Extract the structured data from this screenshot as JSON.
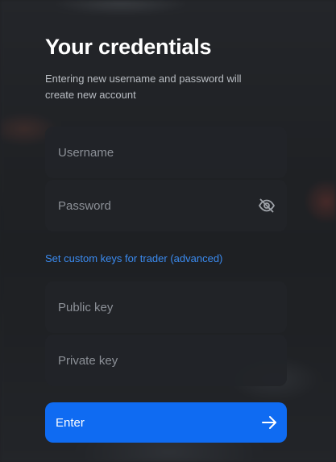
{
  "form": {
    "title": "Your credentials",
    "subtitle": "Entering new username and password will create new account",
    "username": {
      "placeholder": "Username",
      "value": ""
    },
    "password": {
      "placeholder": "Password",
      "value": "",
      "toggle_icon": "eye-off-icon"
    },
    "advanced_link": "Set custom keys for trader (advanced)",
    "public_key": {
      "placeholder": "Public key",
      "value": ""
    },
    "private_key": {
      "placeholder": "Private key",
      "value": ""
    },
    "submit_label": "Enter",
    "submit_icon": "arrow-right-icon"
  },
  "colors": {
    "accent": "#0f6bf2",
    "link": "#3b8bf0",
    "field_bg": "#222428",
    "placeholder": "#8c9097"
  }
}
